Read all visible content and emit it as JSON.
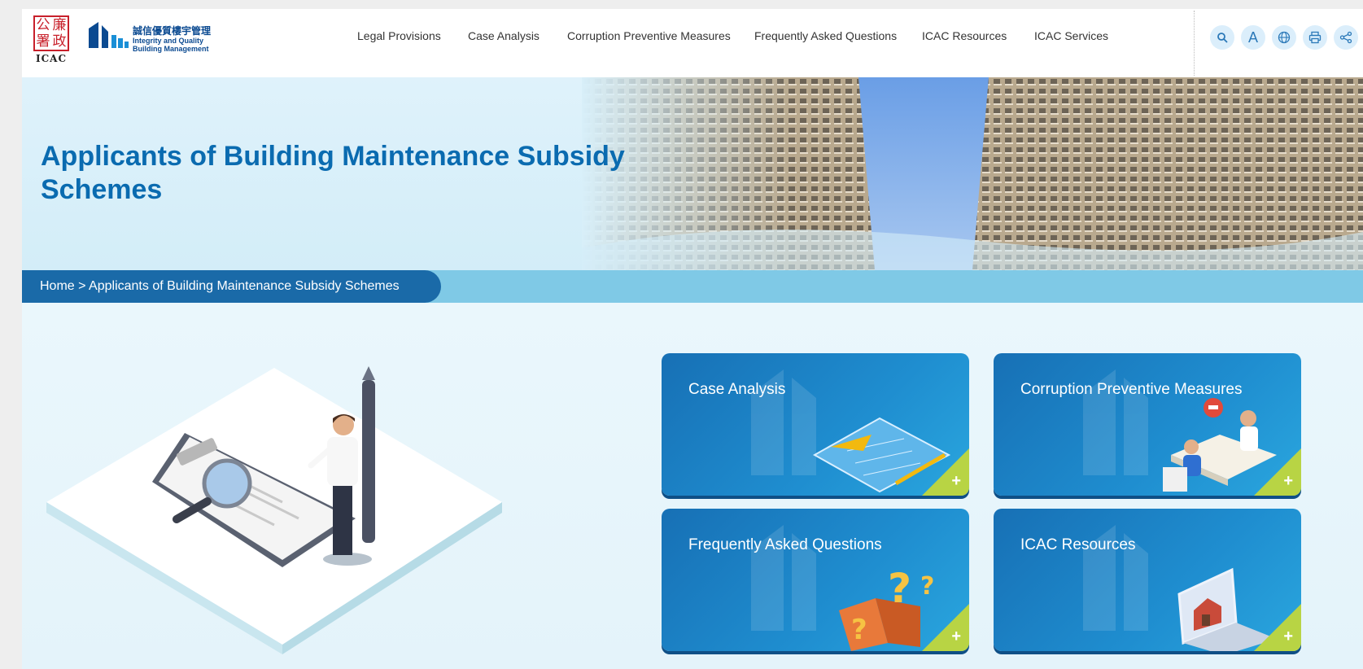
{
  "header": {
    "logo_icac": {
      "seal_chars": [
        "公",
        "廉",
        "署",
        "政"
      ],
      "text": "ICAC"
    },
    "logo_iqbm": {
      "zh": "誠信優質樓宇管理",
      "en_line1": "Integrity and Quality",
      "en_line2": "Building Management"
    },
    "nav": [
      {
        "label": "Legal Provisions"
      },
      {
        "label": "Case Analysis"
      },
      {
        "label": "Corruption Preventive Measures"
      },
      {
        "label": "Frequently Asked Questions"
      },
      {
        "label": "ICAC Resources"
      },
      {
        "label": "ICAC Services"
      }
    ],
    "tools": [
      {
        "icon": "search-icon"
      },
      {
        "icon": "font-size-icon",
        "glyph": "A"
      },
      {
        "icon": "globe-icon"
      },
      {
        "icon": "print-icon"
      },
      {
        "icon": "share-icon"
      }
    ]
  },
  "hero": {
    "title": "Applicants of Building Maintenance Subsidy Schemes"
  },
  "breadcrumb": {
    "home": "Home",
    "separator": " > ",
    "current": "Applicants of Building Maintenance Subsidy Schemes"
  },
  "cards": [
    {
      "title": "Case Analysis",
      "plus": "+"
    },
    {
      "title": "Corruption Preventive Measures",
      "plus": "+"
    },
    {
      "title": "Frequently Asked Questions",
      "plus": "+"
    },
    {
      "title": "ICAC Resources",
      "plus": "+"
    }
  ],
  "colors": {
    "brand_blue": "#0a6bb0",
    "breadcrumb_dark": "#1a6aa8",
    "breadcrumb_light": "#7fc9e6",
    "card_blue": "#1f8ed0",
    "card_accent": "#b8d444"
  }
}
